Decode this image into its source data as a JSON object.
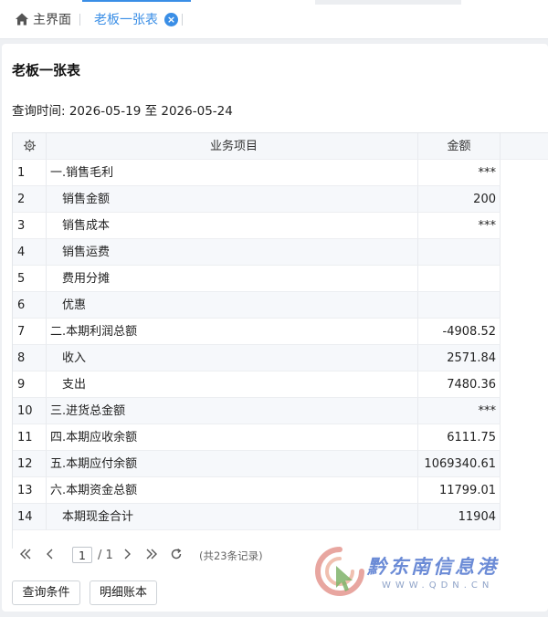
{
  "tabs": {
    "home_label": "主界面",
    "active_label": "老板一张表",
    "close_glyph": "×"
  },
  "page": {
    "title": "老板一张表",
    "query_time": "查询时间: 2026-05-19 至 2026-05-24"
  },
  "table": {
    "columns": [
      "业务项目",
      "金额"
    ],
    "rows": [
      {
        "idx": "1",
        "item": "一.销售毛利",
        "amount": "***"
      },
      {
        "idx": "2",
        "item": "销售金额",
        "amount": "200"
      },
      {
        "idx": "3",
        "item": "销售成本",
        "amount": "***"
      },
      {
        "idx": "4",
        "item": "销售运费",
        "amount": ""
      },
      {
        "idx": "5",
        "item": "费用分摊",
        "amount": ""
      },
      {
        "idx": "6",
        "item": "优惠",
        "amount": ""
      },
      {
        "idx": "7",
        "item": "二.本期利润总额",
        "amount": "-4908.52"
      },
      {
        "idx": "8",
        "item": "收入",
        "amount": "2571.84"
      },
      {
        "idx": "9",
        "item": "支出",
        "amount": "7480.36"
      },
      {
        "idx": "10",
        "item": "三.进货总金额",
        "amount": "***"
      },
      {
        "idx": "11",
        "item": "四.本期应收余额",
        "amount": "6111.75"
      },
      {
        "idx": "12",
        "item": "五.本期应付余额",
        "amount": "1069340.61"
      },
      {
        "idx": "13",
        "item": "六.本期资金总额",
        "amount": "11799.01"
      },
      {
        "idx": "14",
        "item": "本期现金合计",
        "amount": "11904"
      }
    ]
  },
  "pager": {
    "current_page": "1",
    "total_pages": "/ 1",
    "records": "(共23条记录)"
  },
  "buttons": {
    "query_label": "查询条件",
    "detail_label": "明细账本"
  },
  "watermark": {
    "text": "黔东南信息港",
    "sub": "WWW.QDN.CN"
  },
  "colors": {
    "accent": "#3a8ee6",
    "header_bg": "#f5f7fa",
    "alt_row_bg": "#f6f8fb"
  }
}
